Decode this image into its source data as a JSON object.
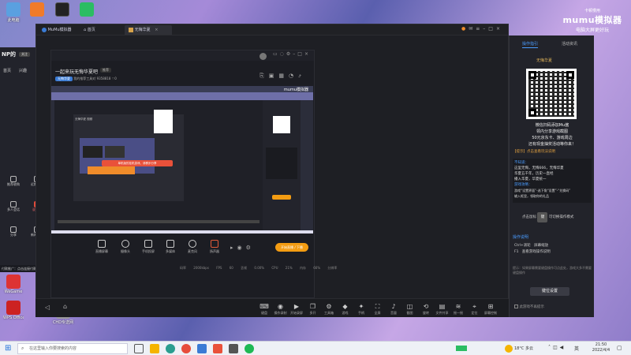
{
  "desktop": {
    "icons_top": [
      {
        "label": "此电脑",
        "color": "#5aa0e0"
      },
      {
        "label": "",
        "color": "#f07b2a"
      },
      {
        "label": "",
        "color": "#222222"
      },
      {
        "label": "",
        "color": "#2bbd63"
      }
    ],
    "icons_left": [
      {
        "label": "WeGame",
        "color": "#d33"
      },
      {
        "label": "WPS Office",
        "color": "#c22"
      },
      {
        "label": "CHD专送网",
        "color": "#999"
      }
    ]
  },
  "mumu_brand": {
    "title": "卡顿慢用",
    "logo": "mumu模拟器",
    "sub": "电脑大屏更好玩"
  },
  "left_panel": {
    "logo": "NP的",
    "chip": "关注",
    "nav": [
      "首页",
      "兴趣"
    ],
    "items": [
      "推荐收购",
      "近期发布",
      "多人会话",
      "说谈课",
      "分享",
      "新闻列表"
    ],
    "bottom_text": "付款推广：点击连接付款可视推荐加载"
  },
  "window": {
    "tabs": [
      {
        "label": "MuMu模拟器"
      },
      {
        "label": "首页"
      },
      {
        "label": "无悔华夏"
      }
    ]
  },
  "stream": {
    "title": "一起来玩无悔华夏吧",
    "tag": "推荐",
    "meta": [
      "无悔华夏",
      "我的推荐工具对",
      "9358818",
      "0"
    ],
    "inner_title": "无悔华夏 视频",
    "banner": "单机版的挂机游戏，请移步分享",
    "overlay_caption": "网络来源 · 无",
    "controls": [
      {
        "label": "直播屏幕",
        "icon": "screen"
      },
      {
        "label": "摄像头",
        "icon": "cam"
      },
      {
        "label": "手机投屏",
        "icon": "phone"
      },
      {
        "label": "多媒体",
        "icon": "media"
      },
      {
        "label": "麦克风",
        "icon": "mic"
      },
      {
        "label": "扬声器",
        "icon": "speaker"
      }
    ],
    "go_live": "开始直播 / 下播",
    "stats": [
      "码率 2000kbps",
      "FPS 60",
      "丢帧 0.00%",
      "CPU 21%",
      "内存 66%",
      "分辨率"
    ]
  },
  "emu_toolbar": [
    {
      "label": "键盘",
      "icon": "⌨"
    },
    {
      "label": "操作录制",
      "icon": "◉"
    },
    {
      "label": "开始录屏",
      "icon": "▶"
    },
    {
      "label": "多开",
      "icon": "❐"
    },
    {
      "label": "工具箱",
      "icon": "⚙"
    },
    {
      "label": "游戏",
      "icon": "◆"
    },
    {
      "label": "手柄",
      "icon": "✦"
    },
    {
      "label": "全屏",
      "icon": "⛶"
    },
    {
      "label": "音量",
      "icon": "♪"
    },
    {
      "label": "截图",
      "icon": "◫"
    },
    {
      "label": "旋转",
      "icon": "⟲"
    },
    {
      "label": "文件共享",
      "icon": "▤"
    },
    {
      "label": "摇一摇",
      "icon": "≋"
    },
    {
      "label": "定位",
      "icon": "⌖"
    },
    {
      "label": "屏幕控制",
      "icon": "⊞"
    }
  ],
  "right_panel": {
    "tabs": [
      "操作指引",
      "活动资讯"
    ],
    "promo_title": "无悔华夏",
    "promo": [
      "微信扫码添加Mu酱",
      "领内分享游戏截图",
      "50元京东卡、游戏周边",
      "还有现金抽奖活动等你来！"
    ],
    "notice_title": "【提示】点击查看玩法说明",
    "info_lines": [
      "不知道：",
      "这里无悔，无悔666，无悔华夏",
      "华夏五千年，历史一直经",
      "播入华夏，华夏统一",
      "游戏攻略：",
      "游戏“设置界面”-选下角“设置”-“兑换码”",
      "输入框里，领取你的礼品"
    ],
    "keyboard_hint": "点击鼠标",
    "key": "键",
    "keyboard_hint2": "可切换操作模式",
    "section": "操作说明",
    "ops": [
      {
        "k": "Ctrl+滚轮",
        "v": "屏幕缩放"
      },
      {
        "k": "F1",
        "v": "查看游戏操作说明"
      }
    ],
    "hint": "提示：如果屏幕需要键盘操作可点此处，游戏大多不需要键盘操作",
    "btn": "键位设置",
    "checkbox": "此游戏不再提示"
  },
  "taskbar": {
    "search_placeholder": "在这里输入你要搜索的内容",
    "weather": "18°C 多云",
    "ime": "英",
    "time": "21:50",
    "date": "2022/4/4"
  },
  "colors": {
    "accent": "#f08c2a",
    "blue": "#3a7bd5",
    "orange_btn": "#f39c12",
    "red_banner": "#e9513a"
  }
}
